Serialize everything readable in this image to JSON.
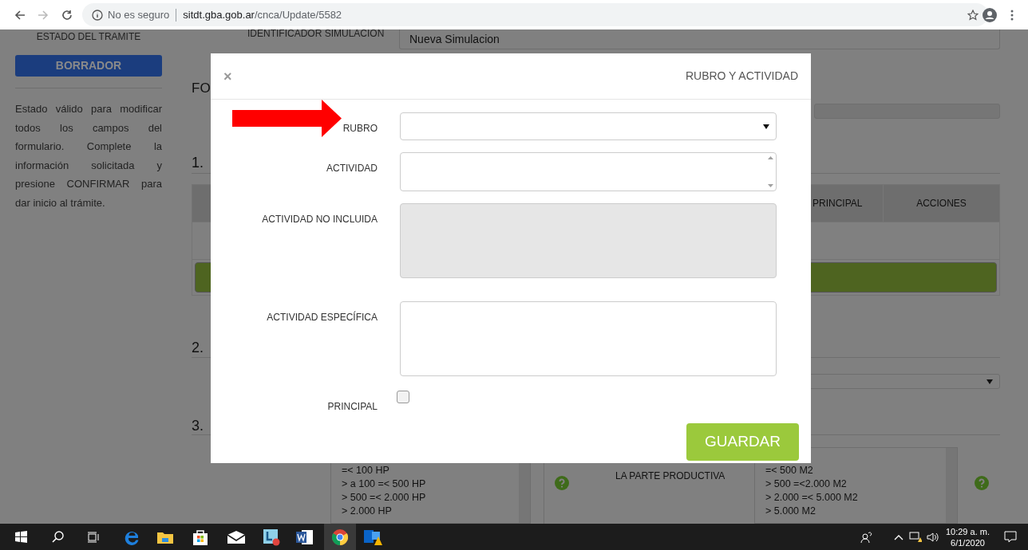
{
  "browser": {
    "security": "No es seguro",
    "url_host": "sitdt.gba.gob.ar",
    "url_path": "/cnca/Update/5582"
  },
  "sidebar": {
    "status_label": "ESTADO DEL TRAMITE",
    "status_badge": "BORRADOR",
    "description": "Estado válido para modificar todos los campos del formulario. Complete la información solicitada y presione CONFIRMAR para dar inicio al trámite."
  },
  "identifier": {
    "label": "IDENTIFICADOR SIMULACION",
    "value": "Nueva Simulacion"
  },
  "form_heading": "FO",
  "sections": [
    "1.",
    "2.",
    "3."
  ],
  "table": {
    "columns": [
      "PRINCIPAL",
      "ACCIONES"
    ]
  },
  "power_options": [
    "=< 100 HP",
    "> a 100 =< 500 HP",
    "> 500 =< 2.000 HP",
    "> 2.000 HP"
  ],
  "productive_label": "LA PARTE PRODUCTIVA",
  "area_options": [
    "=< 500 M2",
    "> 500 =<2.000 M2",
    "> 2.000 =< 5.000 M2",
    "> 5.000 M2"
  ],
  "modal": {
    "close": "×",
    "title": "RUBRO Y ACTIVIDAD",
    "fields": [
      {
        "kind": "select",
        "label": "RUBRO",
        "disabled": false
      },
      {
        "kind": "scroll",
        "label": "ACTIVIDAD",
        "disabled": false
      },
      {
        "kind": "textarea",
        "label": "ACTIVIDAD NO INCLUIDA",
        "disabled": true
      },
      {
        "kind": "textarea",
        "label": "ACTIVIDAD ESPECÍFICA",
        "disabled": false
      },
      {
        "kind": "checkbox",
        "label": "PRINCIPAL",
        "checked": false
      }
    ],
    "save_button": "GUARDAR"
  },
  "taskbar": {
    "time": "10:29 a. m.",
    "date": "6/1/2020"
  }
}
